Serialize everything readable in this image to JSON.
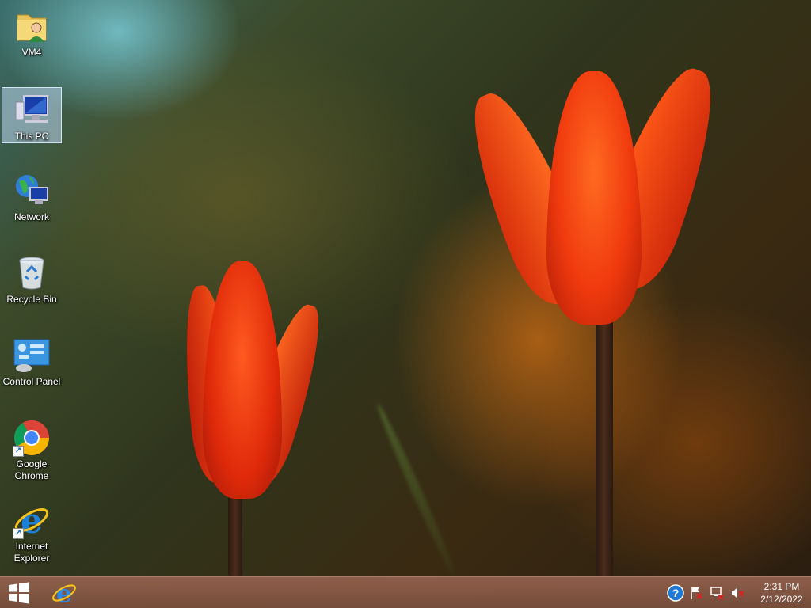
{
  "desktop": {
    "icons": [
      {
        "id": "vm4",
        "label": "VM4",
        "icon": "user-folder-icon"
      },
      {
        "id": "this-pc",
        "label": "This PC",
        "icon": "computer-icon",
        "selected": true
      },
      {
        "id": "network",
        "label": "Network",
        "icon": "network-icon"
      },
      {
        "id": "recycle-bin",
        "label": "Recycle Bin",
        "icon": "recycle-bin-icon"
      },
      {
        "id": "control-panel",
        "label": "Control Panel",
        "icon": "control-panel-icon"
      },
      {
        "id": "google-chrome",
        "label": "Google Chrome",
        "icon": "chrome-icon",
        "shortcut": true
      },
      {
        "id": "internet-explorer",
        "label": "Internet Explorer",
        "icon": "ie-icon",
        "shortcut": true
      }
    ]
  },
  "taskbar": {
    "start_icon": "windows-logo-icon",
    "pinned": [
      {
        "id": "internet-explorer",
        "icon": "ie-icon"
      }
    ],
    "tray": {
      "icons": [
        "help-icon",
        "action-center-flag-icon",
        "network-tray-icon",
        "volume-muted-icon"
      ],
      "time": "2:31 PM",
      "date": "2/12/2022"
    }
  },
  "colors": {
    "taskbar": "#8c5e4a",
    "selection": "#bed7f0",
    "tulip": "#ff4a14"
  }
}
